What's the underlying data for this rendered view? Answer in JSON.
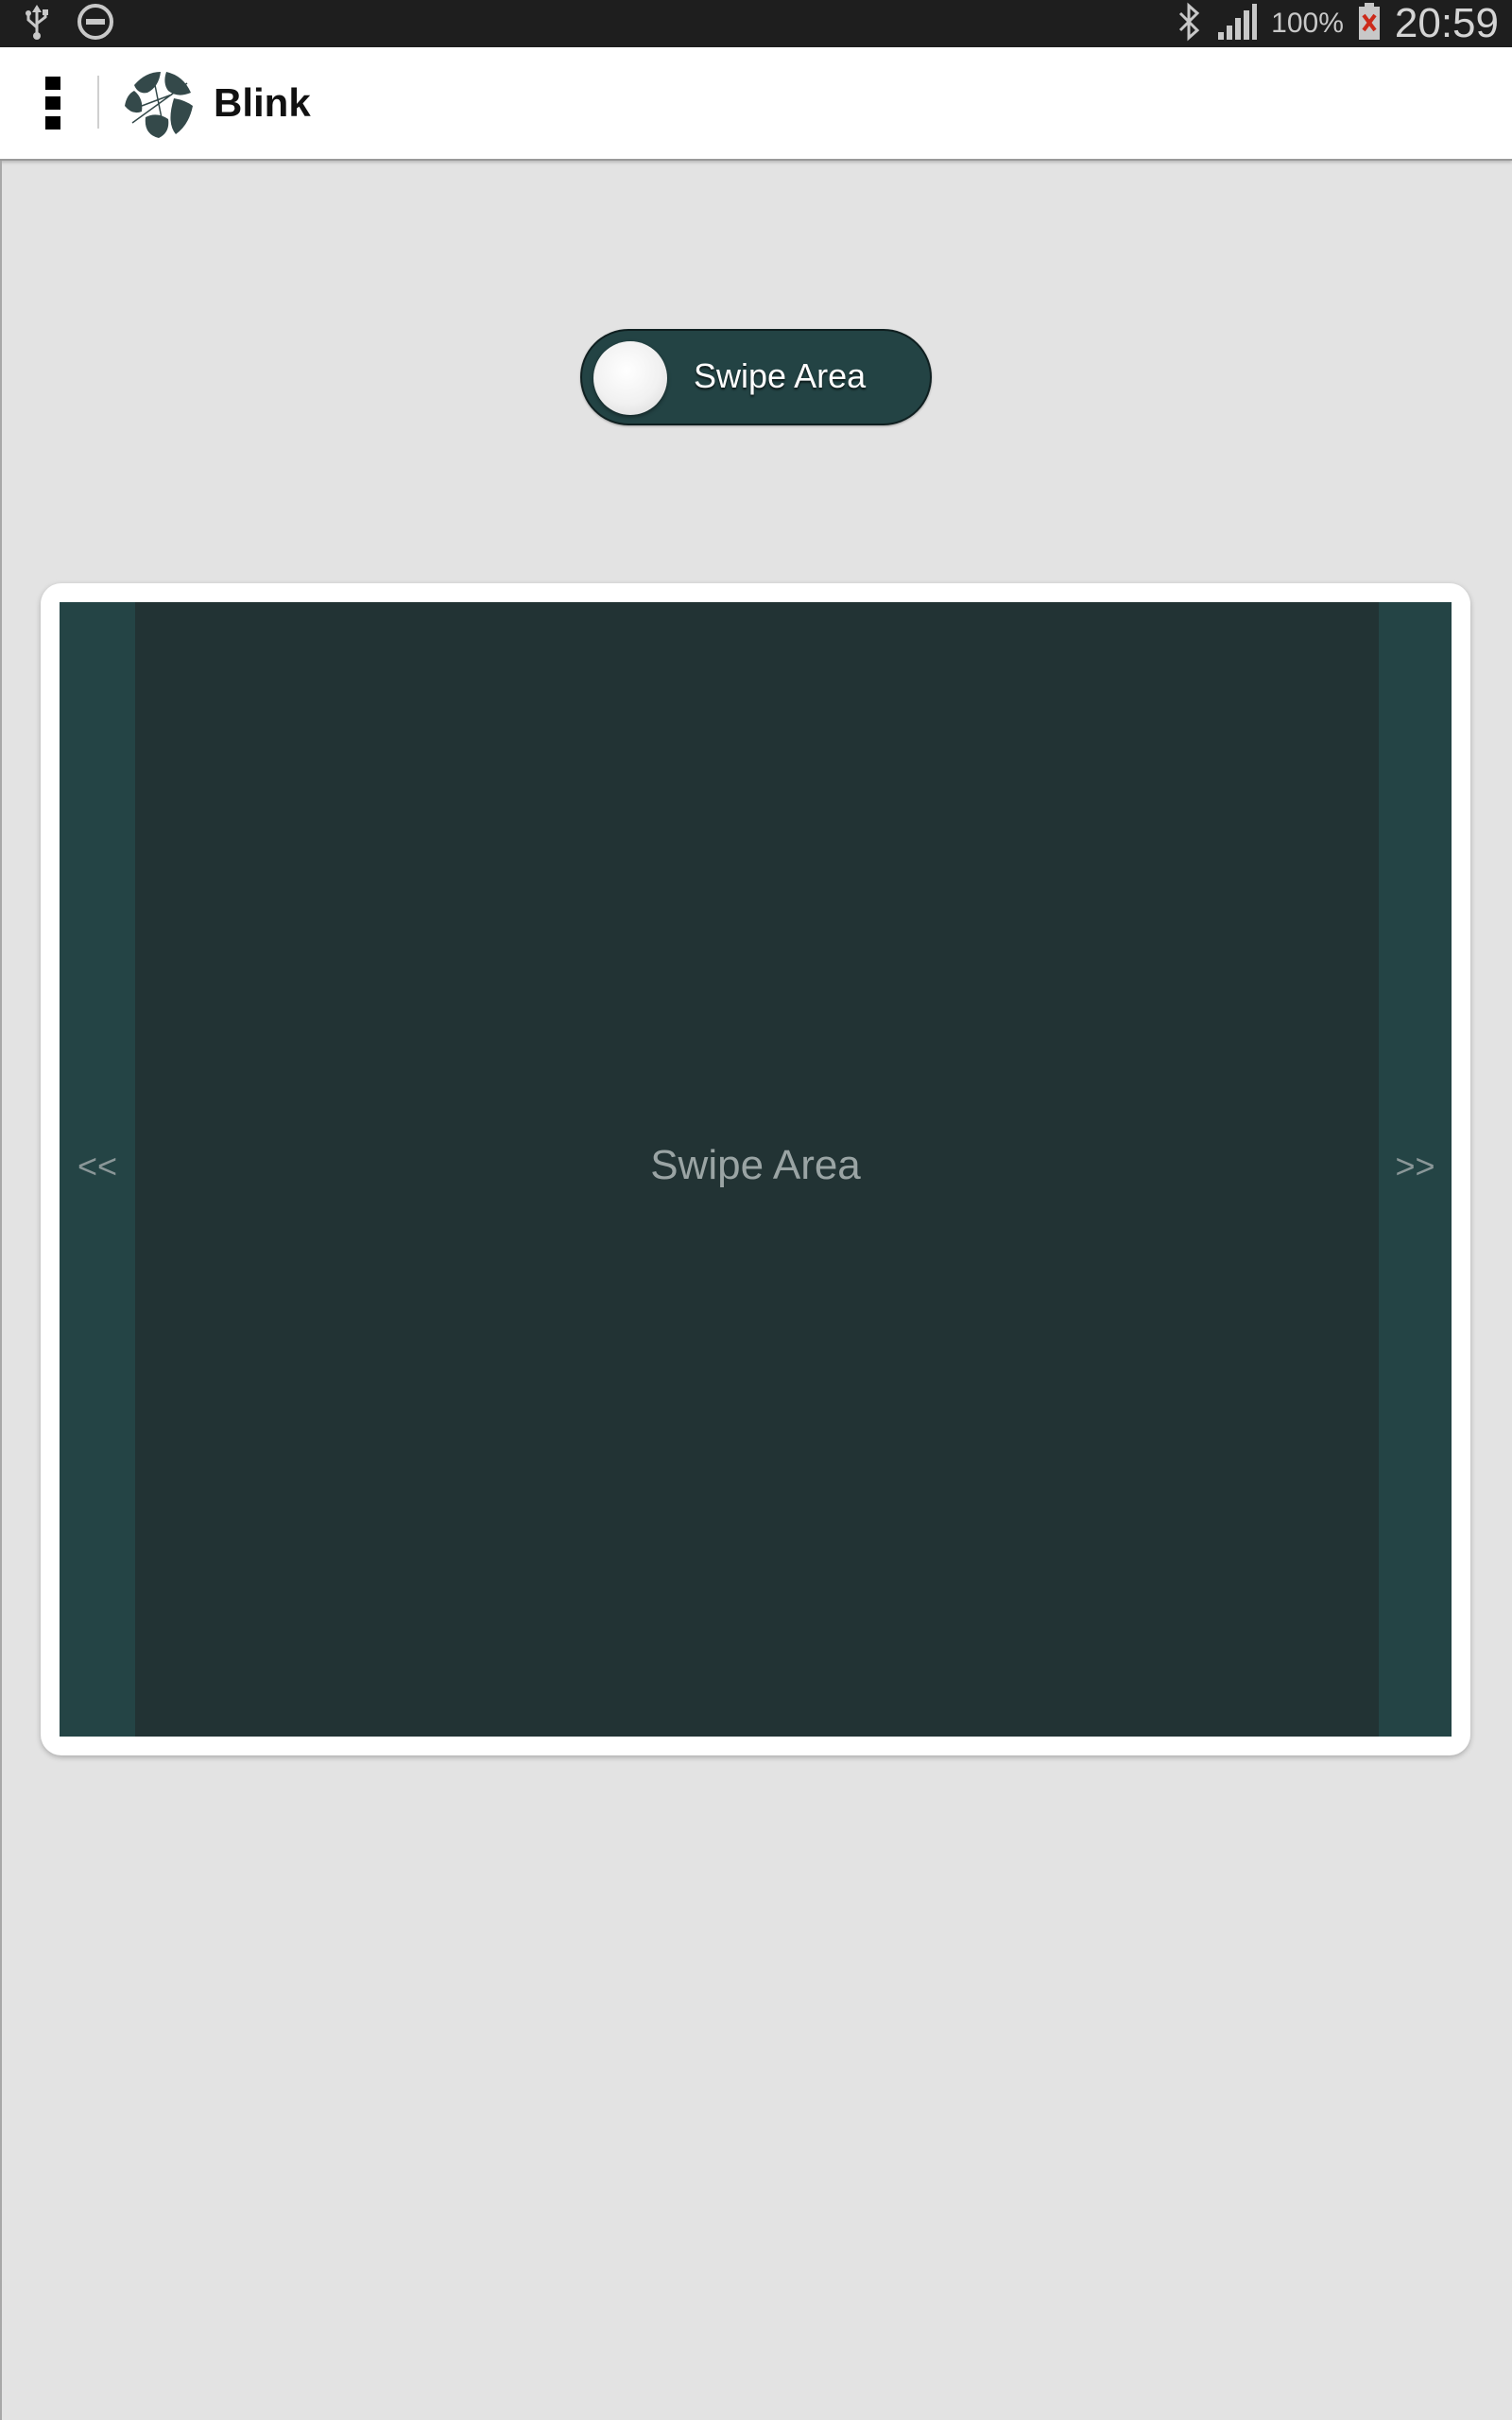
{
  "status_bar": {
    "battery_percent": "100%",
    "time": "20:59",
    "icons": [
      "usb-icon",
      "do-not-disturb-icon",
      "bluetooth-icon",
      "signal-icon",
      "battery-icon"
    ]
  },
  "action_bar": {
    "title": "Blink",
    "icons": [
      "overflow-menu-icon",
      "app-logo-icon"
    ]
  },
  "toggle": {
    "label": "Swipe Area",
    "state": "off"
  },
  "swipe_area": {
    "label": "Swipe Area",
    "prev_label": "<<",
    "next_label": ">>"
  },
  "colors": {
    "background": "#e3e3e3",
    "status_bar": "#1e1e1e",
    "toggle_bg": "#234344",
    "swipe_area": "#223334",
    "swipe_edges": "#244445"
  }
}
